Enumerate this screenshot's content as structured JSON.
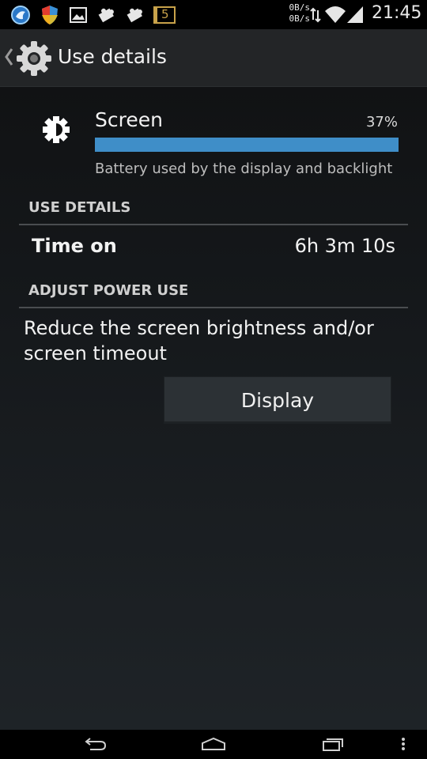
{
  "status_bar": {
    "notification_icons": [
      "browser-globe-icon",
      "shield-icon",
      "image-icon",
      "puzzle-icon",
      "puzzle-icon",
      "calendar-icon"
    ],
    "calendar_badge": "5",
    "net_up": "0B/s",
    "net_down": "0B/s",
    "time": "21:45"
  },
  "action_bar": {
    "title": "Use details",
    "icon": "gear-icon"
  },
  "item": {
    "name": "Screen",
    "percent_text": "37%",
    "bar_fill_fraction": 1.0,
    "subtitle": "Battery used by the display and backlight",
    "icon": "brightness-icon"
  },
  "use_details": {
    "header": "USE DETAILS",
    "rows": [
      {
        "label": "Time on",
        "value": "6h 3m 10s"
      }
    ]
  },
  "adjust_power": {
    "header": "ADJUST POWER USE",
    "advice": "Reduce the screen brightness and/or screen timeout",
    "button_label": "Display"
  },
  "nav_bar": {
    "buttons": [
      "back-icon",
      "home-icon",
      "recents-icon",
      "overflow-menu-icon"
    ]
  },
  "colors": {
    "accent": "#3f8ec8",
    "action_bar": "#232527",
    "divider": "#4a4d50"
  }
}
